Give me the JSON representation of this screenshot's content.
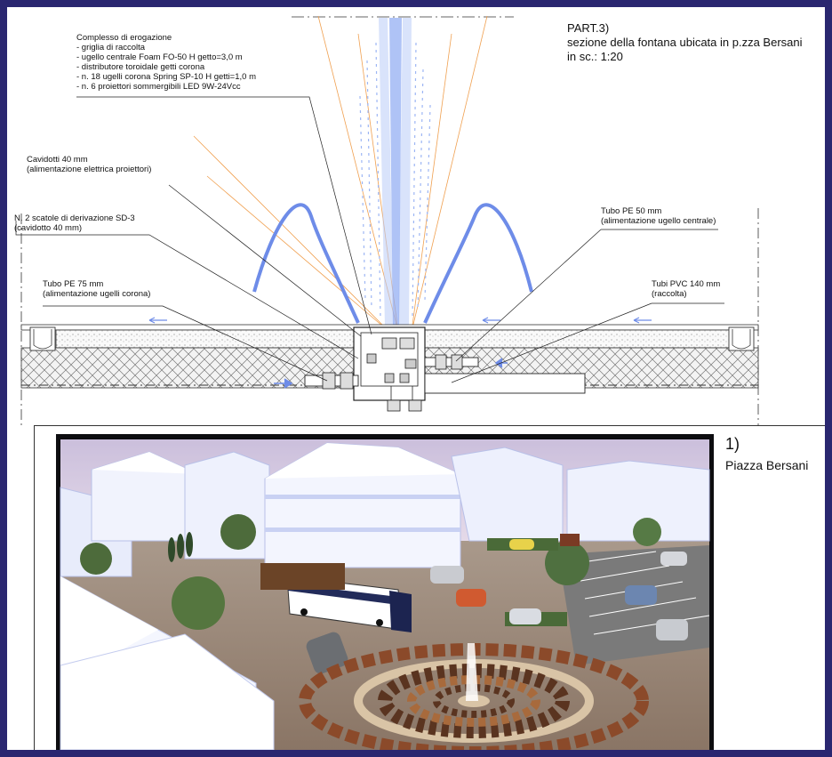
{
  "part": {
    "line1": "PART.3)",
    "line2": "sezione della fontana ubicata in p.zza Bersani",
    "line3": "in sc.: 1:20"
  },
  "legend_main": {
    "title": "Complesso di erogazione",
    "items": [
      "- griglia di raccolta",
      "- ugello centrale Foam FO-50 H getto=3,0 m",
      "- distributore toroidale getti corona",
      "- n. 18 ugelli corona Spring SP-10 H getti=1,0 m",
      "- n. 6 proiettori sommergibili LED 9W-24Vcc"
    ]
  },
  "labels": {
    "cavidotti": [
      "Cavidotti 40 mm",
      "(alimentazione elettrica proiettori)"
    ],
    "scatole": [
      "N. 2 scatole di derivazione SD-3",
      "(cavidotto 40 mm)"
    ],
    "tubo75": [
      "Tubo PE 75 mm",
      "(alimentazione ugelli corona)"
    ],
    "tubo50": [
      "Tubo PE 50 mm",
      "(alimentazione ugello centrale)"
    ],
    "tubi140": [
      "Tubi PVC 140 mm",
      "(raccolta)"
    ]
  },
  "render": {
    "number": "1)",
    "caption": "Piazza Bersani"
  },
  "colors": {
    "frame": "#2a2770",
    "water": "#7f9df0",
    "jet_lines": "#f0a050",
    "sky": "#d9cbe2"
  }
}
